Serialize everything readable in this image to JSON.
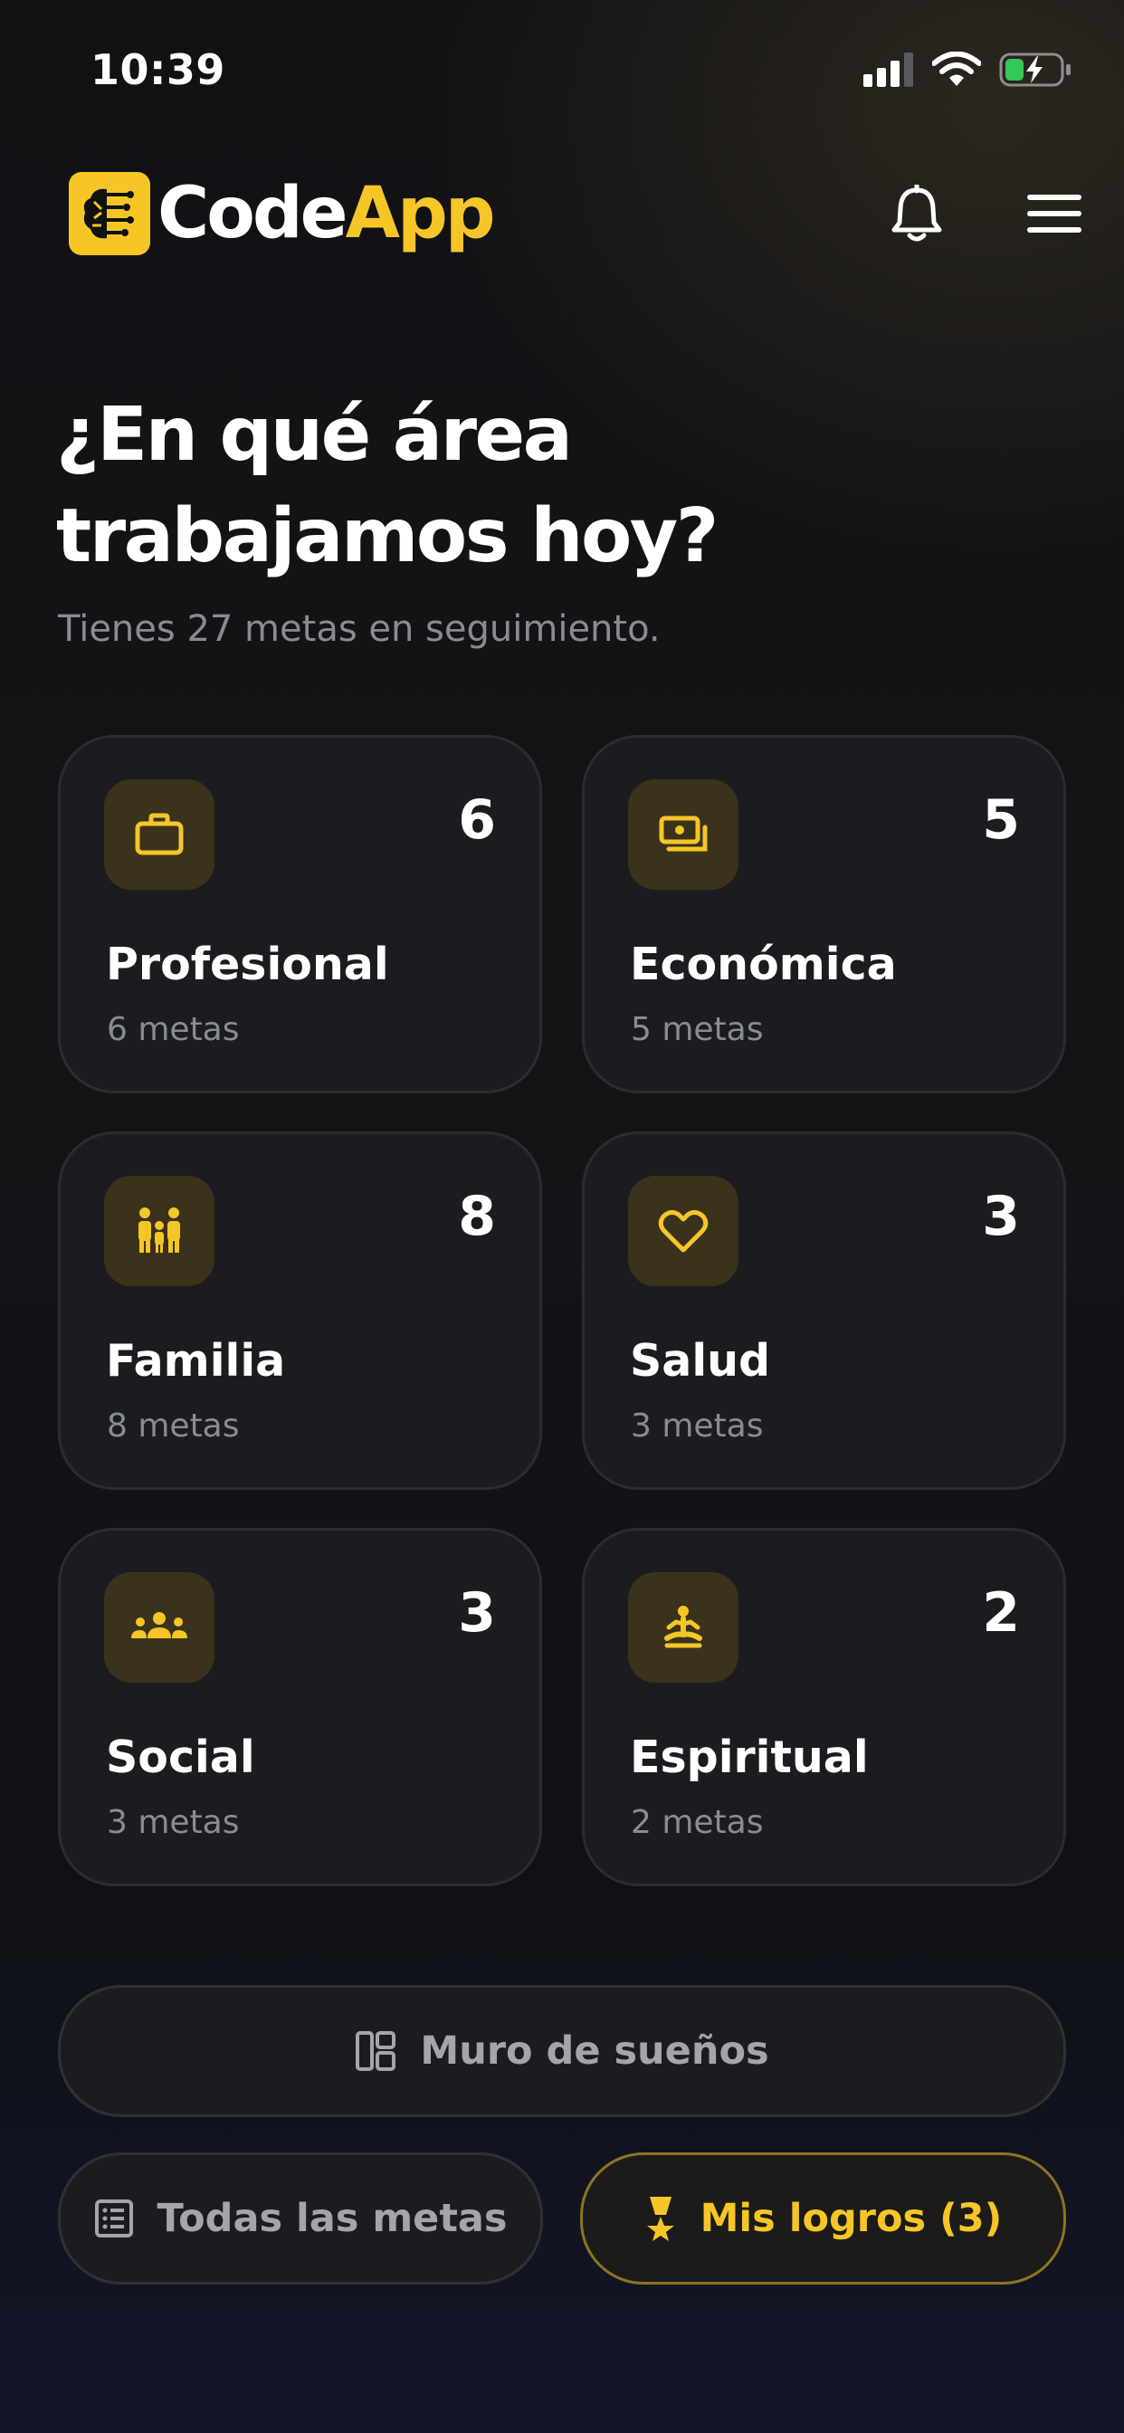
{
  "status_bar": {
    "time": "10:39",
    "icons": [
      "cellular-signal-icon",
      "wifi-icon",
      "battery-charging-icon"
    ]
  },
  "header": {
    "logo_word_white": "Code",
    "logo_word_yellow": "App",
    "icons": [
      "brain-circuit-logo-icon",
      "bell-icon",
      "hamburger-menu-icon"
    ]
  },
  "title": "¿En qué área\ntrabajamos hoy?",
  "subtitle": "Tienes 27 metas en seguimiento.",
  "areas": [
    {
      "name": "Profesional",
      "count": "6",
      "sub": "6 metas",
      "icon": "briefcase-icon"
    },
    {
      "name": "Económica",
      "count": "5",
      "sub": "5 metas",
      "icon": "money-icon"
    },
    {
      "name": "Familia",
      "count": "8",
      "sub": "8 metas",
      "icon": "family-icon"
    },
    {
      "name": "Salud",
      "count": "3",
      "sub": "3 metas",
      "icon": "heart-icon"
    },
    {
      "name": "Social",
      "count": "3",
      "sub": "3 metas",
      "icon": "group-icon"
    },
    {
      "name": "Espiritual",
      "count": "2",
      "sub": "2 metas",
      "icon": "meditation-icon"
    }
  ],
  "buttons": {
    "wall": "Muro de sueños",
    "all_goals": "Todas las metas",
    "achievements": "Mis logros (3)"
  },
  "colors": {
    "accent": "#f6c627",
    "background": "#141417",
    "card": "#1b1c20",
    "icon_tile": "#3a321b",
    "muted_text": "#8a8c93"
  }
}
